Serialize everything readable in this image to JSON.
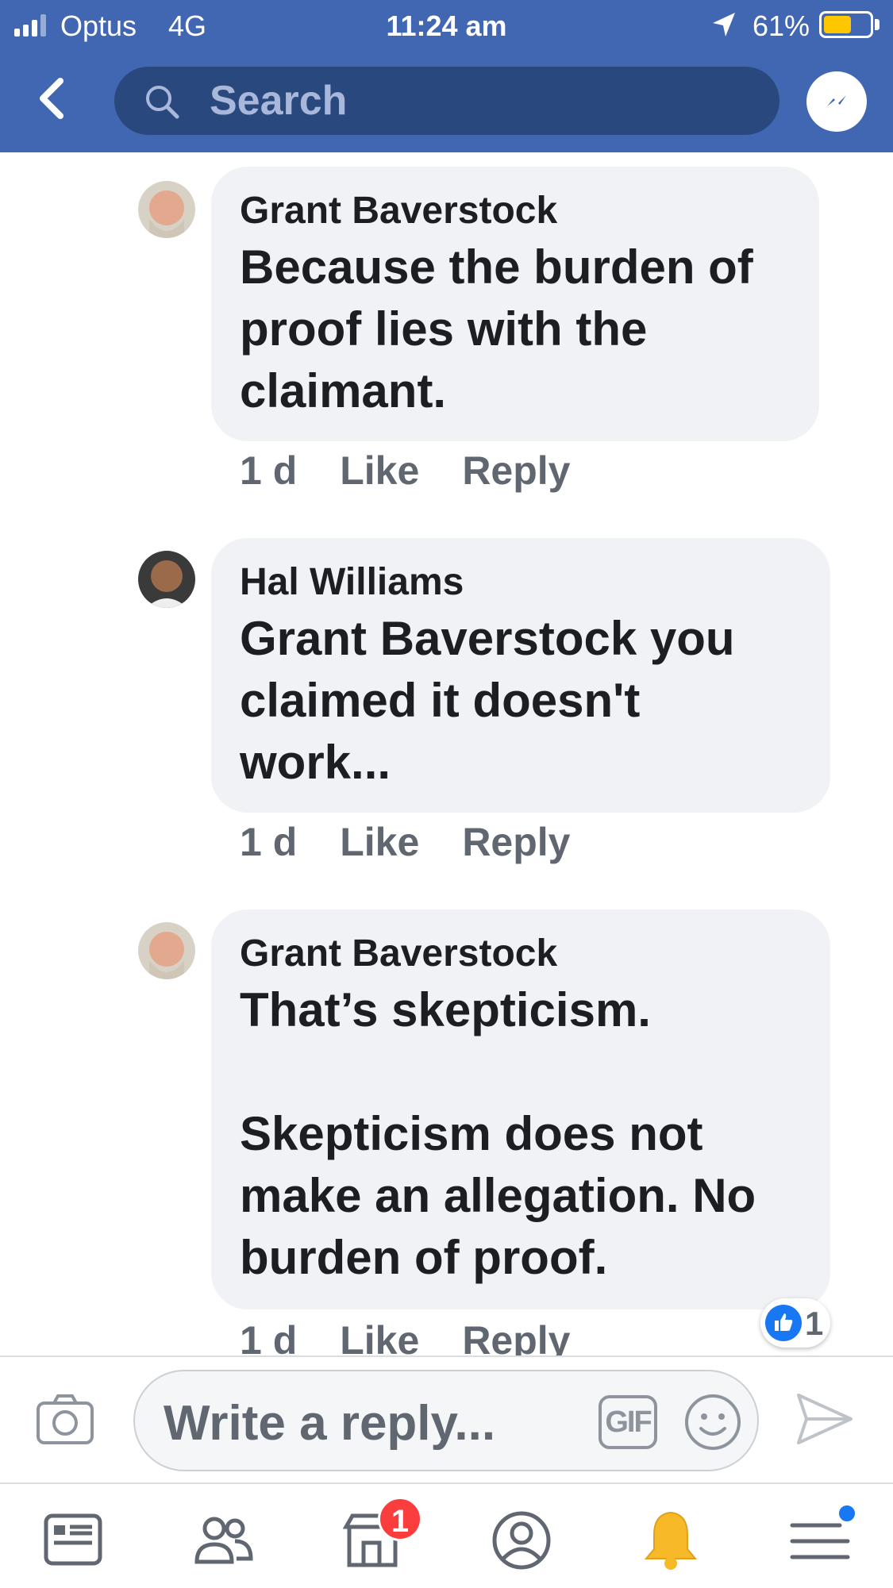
{
  "status_bar": {
    "carrier": "Optus",
    "network": "4G",
    "time": "11:24 am",
    "battery_percent": "61%",
    "battery_level": 0.61,
    "icons": [
      "signal-icon",
      "location-arrow-icon",
      "battery-icon"
    ]
  },
  "header": {
    "back_icon": "chevron-left-icon",
    "search_placeholder": "Search",
    "messenger_icon": "messenger-icon"
  },
  "comments": [
    {
      "author": "Grant Baverstock",
      "mention": "",
      "text": "Because the burden of proof lies with the claimant.",
      "time": "1 d",
      "like_label": "Like",
      "reply_label": "Reply"
    },
    {
      "author": "Hal Williams",
      "mention": "Grant Baverstock",
      "text": " you claimed it doesn't work...",
      "time": "1 d",
      "like_label": "Like",
      "reply_label": "Reply"
    },
    {
      "author": "Grant Baverstock",
      "mention": "",
      "text": "That’s skepticism.",
      "text2": "Skepticism does not make an allegation.  No burden of proof.",
      "time": "1 d",
      "like_label": "Like",
      "reply_label": "Reply",
      "reaction_count": "1"
    }
  ],
  "reply_bar": {
    "placeholder": "Write a reply...",
    "gif_label": "GIF",
    "icons": [
      "camera-icon",
      "gif-icon",
      "emoji-icon",
      "send-icon"
    ]
  },
  "bottom_nav": {
    "items": [
      "news-feed-icon",
      "friends-icon",
      "marketplace-icon",
      "profile-icon",
      "notifications-icon",
      "menu-icon"
    ],
    "marketplace_badge": "1"
  },
  "colors": {
    "header_blue": "#4267b2",
    "search_bg": "#29487d",
    "bubble_bg": "#f0f2f5",
    "like_blue": "#1877f2",
    "badge_red": "#fa3e3e",
    "bell_yellow": "#f7b928"
  }
}
